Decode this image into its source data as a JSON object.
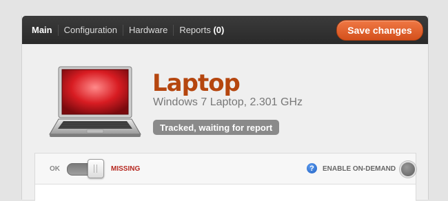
{
  "nav": {
    "items": [
      {
        "label": "Main"
      },
      {
        "label": "Configuration"
      },
      {
        "label": "Hardware"
      },
      {
        "label": "Reports",
        "count": "(0)"
      }
    ],
    "save_label": "Save changes"
  },
  "device": {
    "name": "Laptop",
    "description": "Windows 7 Laptop, 2.301 GHz",
    "status": "Tracked, waiting for report"
  },
  "status_toggle": {
    "left_label": "OK",
    "right_label": "MISSING"
  },
  "on_demand": {
    "help_glyph": "?",
    "label": "ENABLE ON-DEMAND"
  },
  "colors": {
    "accent": "#d4501c",
    "device_title": "#b5460f",
    "missing": "#b5261e"
  }
}
